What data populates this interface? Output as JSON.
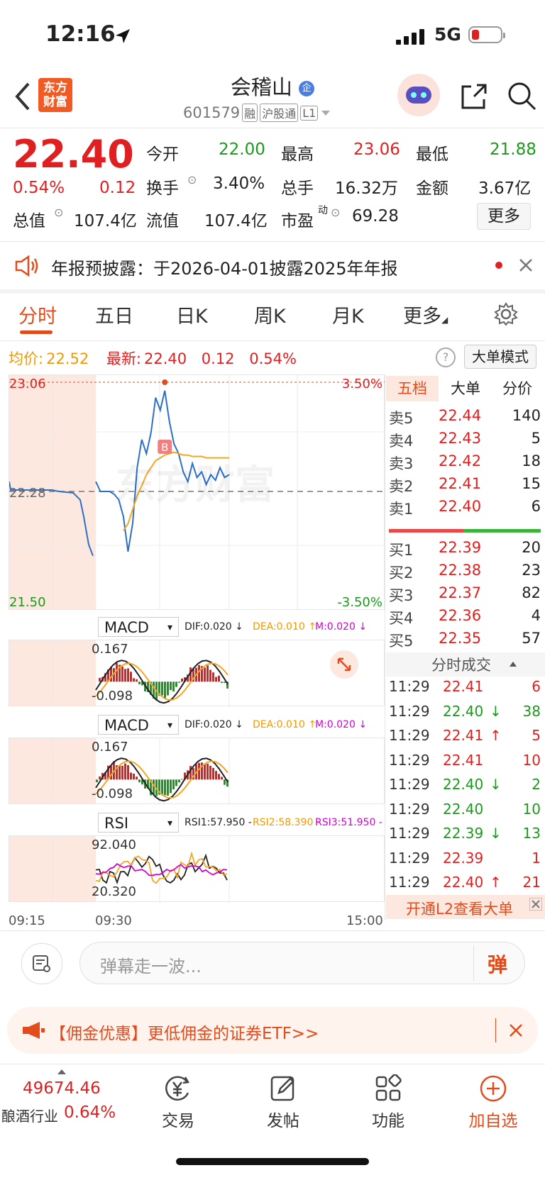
{
  "status_bar": {
    "time": "12:16",
    "network": "5G"
  },
  "header": {
    "logo_text": "东方财富",
    "title": "会稽山",
    "title_badge": "企",
    "code": "601579",
    "tags": [
      "融",
      "沪股通",
      "L1"
    ]
  },
  "quote": {
    "price": "22.40",
    "change_pct": "0.54%",
    "change": "0.12",
    "open_label": "今开",
    "open": "22.00",
    "high_label": "最高",
    "high": "23.06",
    "low_label": "最低",
    "low": "21.88",
    "turnover_label": "换手",
    "turnover": "3.40%",
    "volume_label": "总手",
    "volume": "16.32万",
    "amount_label": "金额",
    "amount": "3.67亿",
    "mktcap_label": "总值",
    "mktcap": "107.4亿",
    "float_label": "流值",
    "float": "107.4亿",
    "pe_label": "市盈",
    "pe_sup": "动",
    "pe": "69.28",
    "more_label": "更多"
  },
  "notice": {
    "text": "年报预披露：于2026-04-01披露2025年年报"
  },
  "tabs": [
    "分时",
    "五日",
    "日K",
    "周K",
    "月K",
    "更多"
  ],
  "chart_header": {
    "avg_label": "均价:",
    "avg": "22.52",
    "last_label": "最新:",
    "last": "22.40",
    "change": "0.12",
    "change_pct": "0.54%",
    "mode_button": "大单模式"
  },
  "chart_data": {
    "type": "line",
    "x_axis_ticks": [
      "09:15",
      "09:30",
      "15:00"
    ],
    "y_left_ticks": [
      "23.06",
      "22.28",
      "21.50"
    ],
    "y_right_ticks": [
      "3.50%",
      "-3.50%"
    ],
    "ylim": [
      21.5,
      23.06
    ],
    "prev_close": 22.28,
    "marker_label": "B",
    "series": [
      {
        "name": "price",
        "color": "#2c6fc8",
        "values": [
          22.35,
          22.28,
          22.28,
          22.28,
          22.26,
          22.22,
          22.1,
          21.85,
          22.05,
          22.45,
          22.65,
          22.55,
          22.7,
          22.95,
          22.86,
          23.0,
          22.78,
          22.62,
          22.55,
          22.42,
          22.35,
          22.48,
          22.38,
          22.42,
          22.33,
          22.4,
          22.36,
          22.45,
          22.38,
          22.4
        ]
      },
      {
        "name": "avg",
        "color": "#f5a623",
        "values": [
          null,
          null,
          null,
          null,
          null,
          null,
          22.0,
          22.05,
          22.15,
          22.25,
          22.32,
          22.4,
          22.45,
          22.5,
          22.52,
          22.54,
          22.55,
          22.56,
          22.55,
          22.54,
          22.54,
          22.53,
          22.53,
          22.53,
          22.52,
          22.52,
          22.52,
          22.52,
          22.52,
          22.52
        ]
      }
    ]
  },
  "indicators": [
    {
      "name": "MACD",
      "dif": "DIF:0.020 ↓",
      "dea": "DEA:0.010 ↑",
      "m": "M:0.020 ↓",
      "top": "0.167",
      "bottom": "-0.098"
    },
    {
      "name": "MACD",
      "dif": "DIF:0.020 ↓",
      "dea": "DEA:0.010 ↑",
      "m": "M:0.020 ↓",
      "top": "0.167",
      "bottom": "-0.098"
    },
    {
      "name": "RSI",
      "dif": "RSI1:57.950 -",
      "dea": "RSI2:58.390 -",
      "m": "RSI3:51.950 -",
      "top": "92.040",
      "bottom": "20.320"
    }
  ],
  "book_tabs": [
    "五档",
    "大单",
    "分价"
  ],
  "asks": [
    {
      "label": "卖5",
      "price": "22.44",
      "vol": "140"
    },
    {
      "label": "卖4",
      "price": "22.43",
      "vol": "5"
    },
    {
      "label": "卖3",
      "price": "22.42",
      "vol": "18"
    },
    {
      "label": "卖2",
      "price": "22.41",
      "vol": "15"
    },
    {
      "label": "卖1",
      "price": "22.40",
      "vol": "6"
    }
  ],
  "bids": [
    {
      "label": "买1",
      "price": "22.39",
      "vol": "20"
    },
    {
      "label": "买2",
      "price": "22.38",
      "vol": "23"
    },
    {
      "label": "买3",
      "price": "22.37",
      "vol": "82"
    },
    {
      "label": "买4",
      "price": "22.36",
      "vol": "4"
    },
    {
      "label": "买5",
      "price": "22.35",
      "vol": "57"
    }
  ],
  "trades_title": "分时成交",
  "trades": [
    {
      "time": "11:29",
      "price": "22.41",
      "arrow": "",
      "vol": "6",
      "color": "red"
    },
    {
      "time": "11:29",
      "price": "22.40",
      "arrow": "↓",
      "vol": "38",
      "color": "green"
    },
    {
      "time": "11:29",
      "price": "22.41",
      "arrow": "↑",
      "vol": "5",
      "color": "red"
    },
    {
      "time": "11:29",
      "price": "22.41",
      "arrow": "",
      "vol": "10",
      "color": "red"
    },
    {
      "time": "11:29",
      "price": "22.40",
      "arrow": "↓",
      "vol": "2",
      "color": "green"
    },
    {
      "time": "11:29",
      "price": "22.40",
      "arrow": "",
      "vol": "10",
      "color": "green"
    },
    {
      "time": "11:29",
      "price": "22.39",
      "arrow": "↓",
      "vol": "13",
      "color": "green"
    },
    {
      "time": "11:29",
      "price": "22.39",
      "arrow": "",
      "vol": "1",
      "color": "red"
    },
    {
      "time": "11:29",
      "price": "22.40",
      "arrow": "↑",
      "vol": "21",
      "color": "red"
    }
  ],
  "l2_banner": "开通L2查看大单",
  "danmaku": {
    "placeholder": "弹幕走一波...",
    "send": "弹"
  },
  "promo": {
    "text": "【佣金优惠】更低佣金的证券ETF>>"
  },
  "bottom_nav": {
    "index_value": "49674.46",
    "index_name": "酿酒行业",
    "index_change": "0.64%",
    "items": [
      "交易",
      "发帖",
      "功能",
      "加自选"
    ]
  }
}
